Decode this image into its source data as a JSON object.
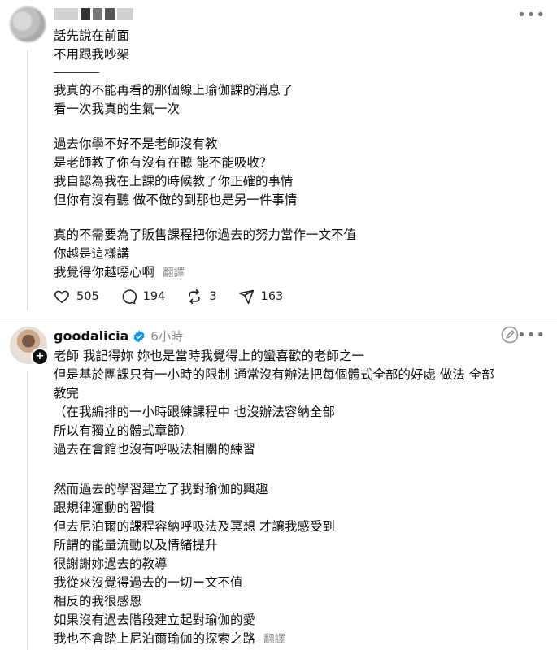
{
  "post1": {
    "lines_a": [
      "話先說在前面",
      "不用跟我吵架"
    ],
    "lines_b": [
      "我真的不能再看的那個線上瑜伽課的消息了",
      "看一次我真的生氣一次"
    ],
    "lines_c": [
      "過去你學不好不是老師沒有教",
      "是老師教了你有沒有在聽 能不能吸收？",
      "我自認為我在上課的時候教了你正確的事情",
      "但你有沒有聽 做不做的到那也是另一件事情"
    ],
    "lines_d": [
      "真的不需要為了販售課程把你過去的努力當作一文不值",
      "你越是這樣講"
    ],
    "last_line": "我覺得你越噁心啊",
    "translate": "翻譯",
    "likes": "505",
    "comments": "194",
    "reposts": "3",
    "shares": "163"
  },
  "post2": {
    "username": "goodalicia",
    "time": "6小時",
    "lines_a": [
      "老師 我記得妳 妳也是當時我覺得上的蠻喜歡的老師之一",
      "但是基於團課只有一小時的限制 通常沒有辦法把每個體式全部的好處 做法 全部",
      "教完",
      "（在我編排的一小時跟練課程中 也沒辦法容納全部",
      "所以有獨立的體式章節）",
      "過去在會館也沒有呼吸法相關的練習"
    ],
    "lines_b": [
      "然而過去的學習建立了我對瑜伽的興趣",
      "跟規律運動的習慣",
      "但去尼泊爾的課程容納呼吸法及冥想 才讓我感受到",
      "所謂的能量流動以及情緒提升",
      "很謝謝妳過去的教導",
      "我從來沒覺得過去的一切ー文不值",
      "相反的我很感恩",
      "如果沒有過去階段建立起對瑜伽的愛"
    ],
    "last_line": "我也不會踏上尼泊爾瑜伽的探索之路",
    "translate": "翻譯"
  },
  "icons": {
    "like": "heart-icon",
    "comment": "comment-icon",
    "repost": "repost-icon",
    "share": "share-icon",
    "more": "more-horizontal-icon",
    "verified": "verified-badge-icon",
    "edit": "edit-off-icon",
    "follow": "plus-icon"
  },
  "colors": {
    "text": "#111111",
    "muted": "#8c8c8c",
    "verified": "#0095f6"
  }
}
